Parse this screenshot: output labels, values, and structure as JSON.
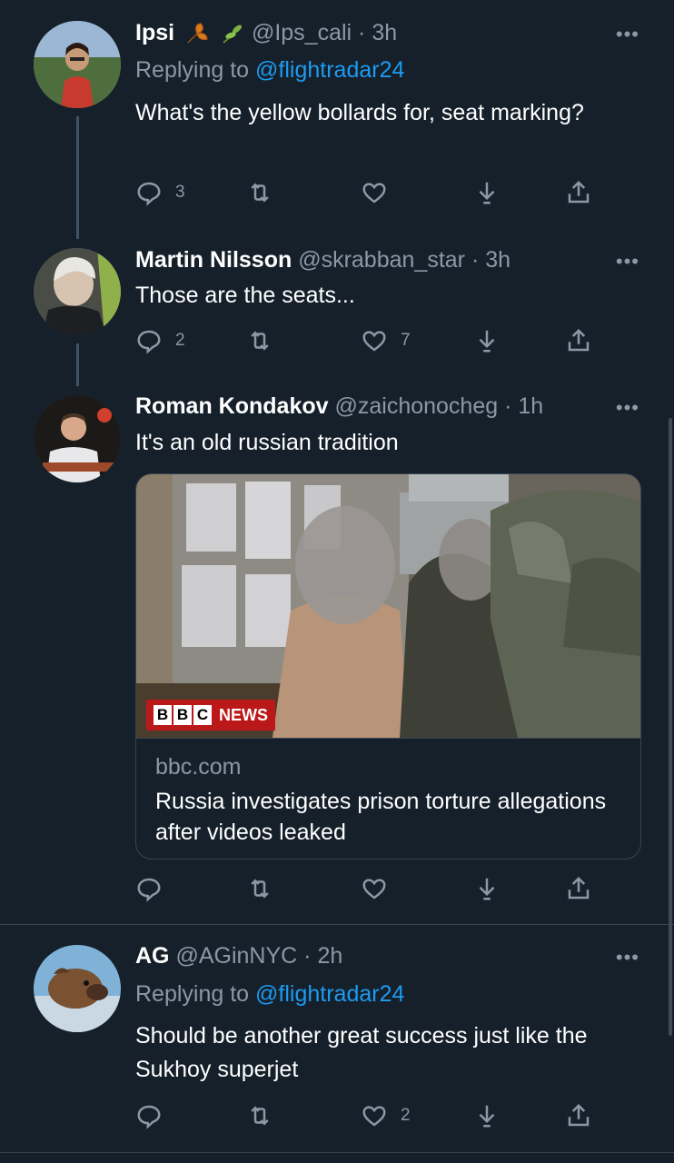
{
  "tweets": [
    {
      "name": "Ipsi",
      "handle": "@Ips_cali",
      "dot": "·",
      "time": "3h",
      "replying_prefix": "Replying to ",
      "replying_mention": "@flightradar24",
      "text": "What's the yellow bollards for, seat marking?",
      "reply_count": "3",
      "retweet_count": "",
      "like_count": "",
      "name_emojis": [
        "maple-leaf-emoji",
        "herb-emoji"
      ]
    },
    {
      "name": "Martin Nilsson",
      "handle": "@skrabban_star",
      "dot": "·",
      "time": "3h",
      "text": "Those are the seats...",
      "reply_count": "2",
      "retweet_count": "",
      "like_count": "7"
    },
    {
      "name": "Roman Kondakov",
      "handle": "@zaichonocheg",
      "dot": "·",
      "time": "1h",
      "text": "It's an old russian tradition",
      "reply_count": "",
      "retweet_count": "",
      "like_count": "",
      "card": {
        "badge_letters": [
          "B",
          "B",
          "C"
        ],
        "badge_news": "NEWS",
        "domain": "bbc.com",
        "title": "Russia investigates prison torture allegations after videos leaked"
      }
    },
    {
      "name": "AG",
      "handle": "@AGinNYC",
      "dot": "·",
      "time": "2h",
      "replying_prefix": "Replying to ",
      "replying_mention": "@flightradar24",
      "text": "Should be another great success just like the Sukhoy superjet",
      "reply_count": "",
      "retweet_count": "",
      "like_count": "2"
    }
  ],
  "more_glyph": "•••",
  "colors": {
    "background": "#15202b",
    "secondary_text": "#8b98a5",
    "link": "#1d9bf0",
    "divider": "#38444d",
    "bbc_red": "#bb1919"
  }
}
